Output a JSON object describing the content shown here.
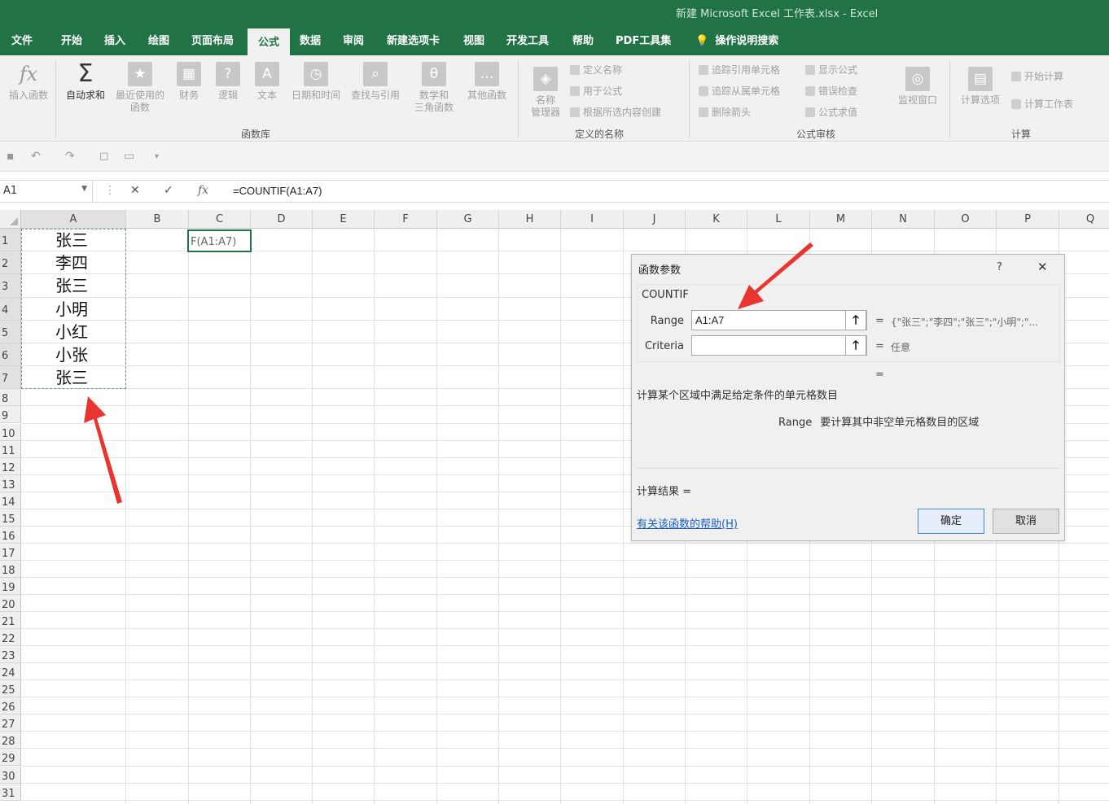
{
  "window": {
    "title": "新建 Microsoft Excel 工作表.xlsx  -  Excel"
  },
  "tabs": [
    "文件",
    "开始",
    "插入",
    "绘图",
    "页面布局",
    "公式",
    "数据",
    "审阅",
    "新建选项卡",
    "视图",
    "开发工具",
    "帮助",
    "PDF工具集",
    "操作说明搜索"
  ],
  "active_tab": "公式",
  "ribbon": {
    "insert_function": "插入函数",
    "autosum": "自动求和",
    "recent_1": "最近使用的",
    "recent_2": "函数",
    "financial": "财务",
    "logical": "逻辑",
    "text": "文本",
    "datetime": "日期和时间",
    "lookup": "查找与引用",
    "math_1": "数学和",
    "math_2": "三角函数",
    "more": "其他函数",
    "group_library": "函数库",
    "name_manager_1": "名称",
    "name_manager_2": "管理器",
    "define_name": "定义名称",
    "use_in_formula": "用于公式",
    "create_from_selection": "根据所选内容创建",
    "group_names": "定义的名称",
    "trace_precedents": "追踪引用单元格",
    "trace_dependents": "追踪从属单元格",
    "remove_arrows": "删除箭头",
    "show_formulas": "显示公式",
    "error_checking": "错误检查",
    "evaluate_formula": "公式求值",
    "watch_window": "监视窗口",
    "group_auditing": "公式审核",
    "calc_options": "计算选项",
    "calc_now": "开始计算",
    "calc_sheet": "计算工作表",
    "group_calc": "计算"
  },
  "formula_bar": {
    "name_box": "A1",
    "formula": "=COUNTIF(A1:A7)"
  },
  "columns": [
    "A",
    "B",
    "C",
    "D",
    "E",
    "F",
    "G",
    "H",
    "I",
    "J",
    "K",
    "L",
    "M",
    "N",
    "O",
    "P",
    "Q"
  ],
  "rows": [
    "1",
    "2",
    "3",
    "4",
    "5",
    "6",
    "7",
    "8",
    "9",
    "10",
    "11",
    "12",
    "13",
    "14",
    "15",
    "16",
    "17",
    "18",
    "19",
    "20",
    "21",
    "22",
    "23",
    "24",
    "25",
    "26",
    "27",
    "28",
    "29",
    "30",
    "31"
  ],
  "cells_A": [
    "张三",
    "李四",
    "张三",
    "小明",
    "小红",
    "小张",
    "张三"
  ],
  "active_cell_text": "F(A1:A7)",
  "dialog": {
    "title": "函数参数",
    "help_glyph": "?",
    "close_glyph": "✕",
    "function_name": "COUNTIF",
    "range_label": "Range",
    "range_value": "A1:A7",
    "range_result": "{\"张三\";\"李四\";\"张三\";\"小明\";\"...",
    "criteria_label": "Criteria",
    "criteria_value": "",
    "criteria_result": "任意",
    "eq": "=",
    "description": "计算某个区域中满足给定条件的单元格数目",
    "arg_name": "Range",
    "arg_description": "要计算其中非空单元格数目的区域",
    "calc_result": "计算结果 =",
    "help_link": "有关该函数的帮助(H)",
    "ok": "确定",
    "cancel": "取消"
  },
  "colors": {
    "excel_green": "#217346",
    "arrow_red": "#e8352f"
  }
}
